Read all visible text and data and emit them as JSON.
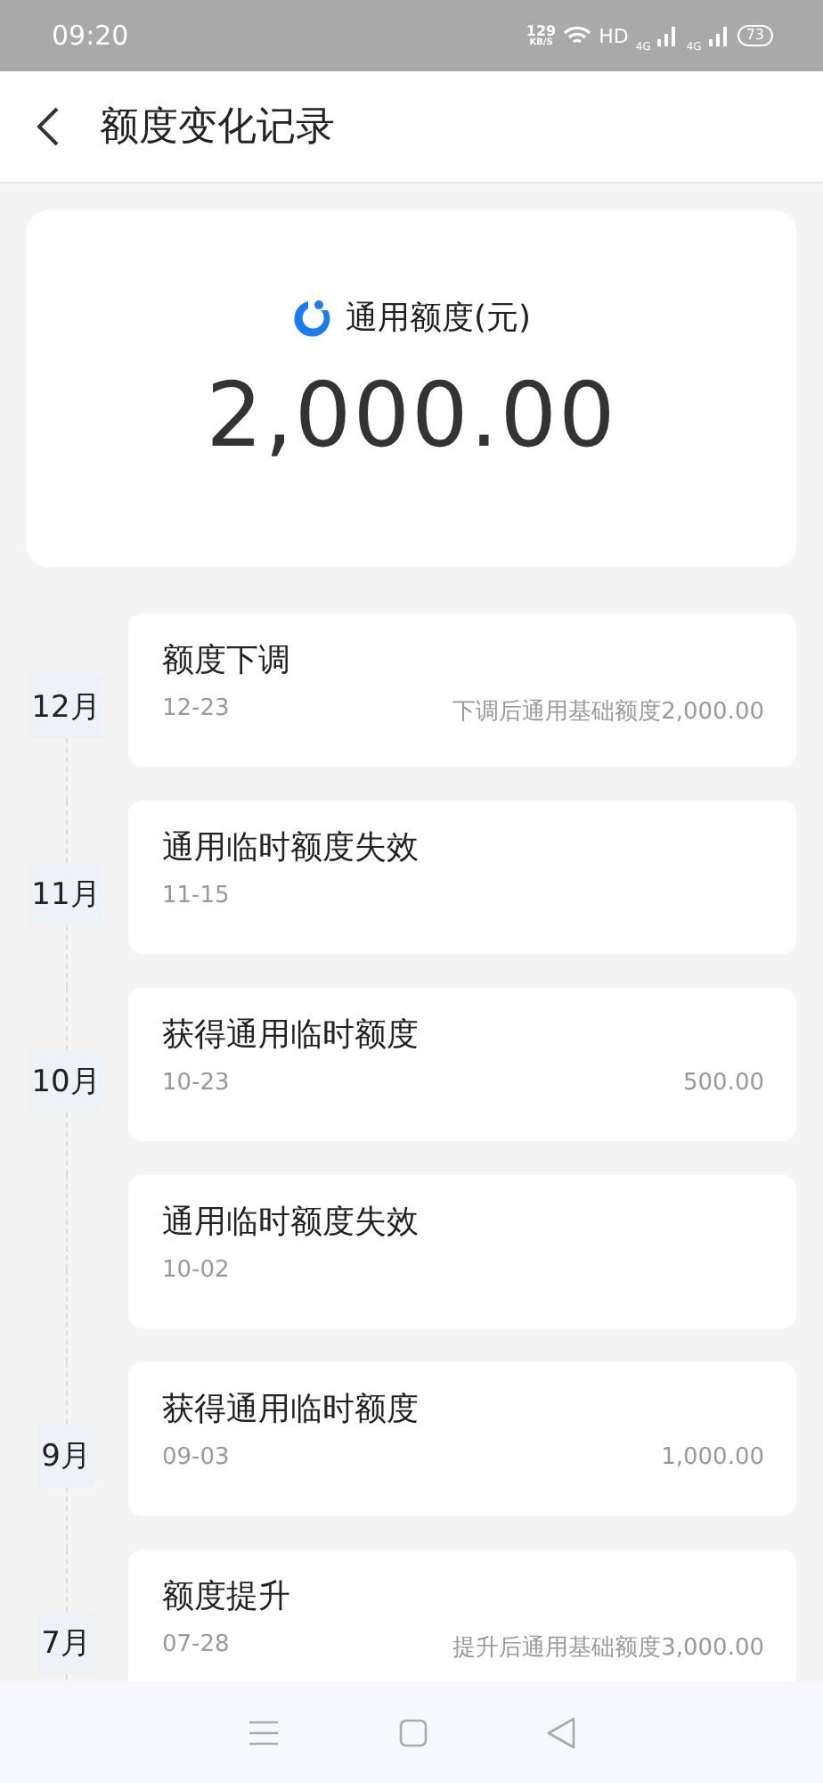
{
  "status_bar": {
    "time": "09:20",
    "speed": "129",
    "speed_unit": "KB/S",
    "hd": "HD",
    "network_1": "4G",
    "network_2": "4G",
    "battery": "73"
  },
  "header": {
    "title": "额度变化记录"
  },
  "summary": {
    "label": "通用额度(元)",
    "amount": "2,000.00"
  },
  "records": [
    {
      "month": "12月",
      "title": "额度下调",
      "date": "12-23",
      "note": "下调后通用基础额度2,000.00"
    },
    {
      "month": "11月",
      "title": "通用临时额度失效",
      "date": "11-15"
    },
    {
      "month": "10月",
      "title": "获得通用临时额度",
      "date": "10-23",
      "note": "500.00"
    },
    {
      "title": "通用临时额度失效",
      "date": "10-02"
    },
    {
      "month": "9月",
      "title": "获得通用临时额度",
      "date": "09-03",
      "note": "1,000.00"
    },
    {
      "month": "7月",
      "title": "额度提升",
      "date": "07-28",
      "note": "提升后通用基础额度3,000.00"
    }
  ]
}
